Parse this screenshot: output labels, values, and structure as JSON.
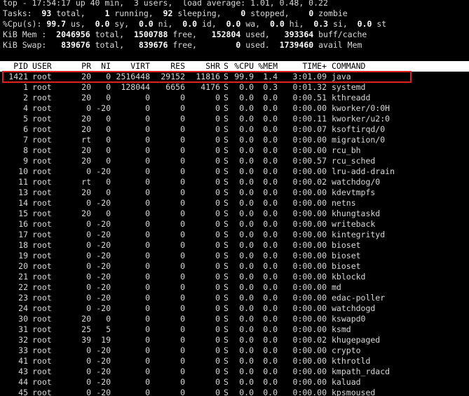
{
  "summary": {
    "top_line": "top - 17:54:17 up 40 min,  3 users,  load average: 1.01, 0.48, 0.22",
    "tasks": {
      "label": "Tasks:",
      "total": "93",
      "total_label": " total,",
      "running": "1",
      "running_label": " running,",
      "sleeping": "92",
      "sleeping_label": " sleeping,",
      "stopped": "0",
      "stopped_label": " stopped,",
      "zombie": "0",
      "zombie_label": " zombie"
    },
    "cpu": {
      "label": "%Cpu(s):",
      "us": "99.7",
      "us_label": " us,",
      "sy": "0.0",
      "sy_label": " sy,",
      "ni": "0.0",
      "ni_label": " ni,",
      "id": "0.0",
      "id_label": " id,",
      "wa": "0.0",
      "wa_label": " wa,",
      "hi": "0.0",
      "hi_label": " hi,",
      "si": "0.3",
      "si_label": " si,",
      "st": "0.0",
      "st_label": " st"
    },
    "mem": {
      "label": "KiB Mem :",
      "total": "2046956",
      "total_label": " total,",
      "free": "1500788",
      "free_label": " free,",
      "used": "152804",
      "used_label": " used,",
      "buff": "393364",
      "buff_label": " buff/cache"
    },
    "swap": {
      "label": "KiB Swap:",
      "total": "839676",
      "total_label": " total,",
      "free": "839676",
      "free_label": " free,",
      "used": "0",
      "used_label": " used.",
      "avail": "1739460",
      "avail_label": " avail Mem"
    }
  },
  "columns": [
    "PID",
    "USER",
    "PR",
    "NI",
    "VIRT",
    "RES",
    "SHR",
    "S",
    "%CPU",
    "%MEM",
    "TIME+",
    "COMMAND"
  ],
  "processes": [
    [
      "1421",
      "root",
      "20",
      "0",
      "2516448",
      "29152",
      "11816",
      "S",
      "99.9",
      "1.4",
      "3:01.09",
      "java"
    ],
    [
      "1",
      "root",
      "20",
      "0",
      "128044",
      "6656",
      "4176",
      "S",
      "0.0",
      "0.3",
      "0:01.32",
      "systemd"
    ],
    [
      "2",
      "root",
      "20",
      "0",
      "0",
      "0",
      "0",
      "S",
      "0.0",
      "0.0",
      "0:00.51",
      "kthreadd"
    ],
    [
      "4",
      "root",
      "0",
      "-20",
      "0",
      "0",
      "0",
      "S",
      "0.0",
      "0.0",
      "0:00.00",
      "kworker/0:0H"
    ],
    [
      "5",
      "root",
      "20",
      "0",
      "0",
      "0",
      "0",
      "S",
      "0.0",
      "0.0",
      "0:00.11",
      "kworker/u2:0"
    ],
    [
      "6",
      "root",
      "20",
      "0",
      "0",
      "0",
      "0",
      "S",
      "0.0",
      "0.0",
      "0:00.07",
      "ksoftirqd/0"
    ],
    [
      "7",
      "root",
      "rt",
      "0",
      "0",
      "0",
      "0",
      "S",
      "0.0",
      "0.0",
      "0:00.00",
      "migration/0"
    ],
    [
      "8",
      "root",
      "20",
      "0",
      "0",
      "0",
      "0",
      "S",
      "0.0",
      "0.0",
      "0:00.00",
      "rcu_bh"
    ],
    [
      "9",
      "root",
      "20",
      "0",
      "0",
      "0",
      "0",
      "S",
      "0.0",
      "0.0",
      "0:00.57",
      "rcu_sched"
    ],
    [
      "10",
      "root",
      "0",
      "-20",
      "0",
      "0",
      "0",
      "S",
      "0.0",
      "0.0",
      "0:00.00",
      "lru-add-drain"
    ],
    [
      "11",
      "root",
      "rt",
      "0",
      "0",
      "0",
      "0",
      "S",
      "0.0",
      "0.0",
      "0:00.02",
      "watchdog/0"
    ],
    [
      "13",
      "root",
      "20",
      "0",
      "0",
      "0",
      "0",
      "S",
      "0.0",
      "0.0",
      "0:00.00",
      "kdevtmpfs"
    ],
    [
      "14",
      "root",
      "0",
      "-20",
      "0",
      "0",
      "0",
      "S",
      "0.0",
      "0.0",
      "0:00.00",
      "netns"
    ],
    [
      "15",
      "root",
      "20",
      "0",
      "0",
      "0",
      "0",
      "S",
      "0.0",
      "0.0",
      "0:00.00",
      "khungtaskd"
    ],
    [
      "16",
      "root",
      "0",
      "-20",
      "0",
      "0",
      "0",
      "S",
      "0.0",
      "0.0",
      "0:00.00",
      "writeback"
    ],
    [
      "17",
      "root",
      "0",
      "-20",
      "0",
      "0",
      "0",
      "S",
      "0.0",
      "0.0",
      "0:00.00",
      "kintegrityd"
    ],
    [
      "18",
      "root",
      "0",
      "-20",
      "0",
      "0",
      "0",
      "S",
      "0.0",
      "0.0",
      "0:00.00",
      "bioset"
    ],
    [
      "19",
      "root",
      "0",
      "-20",
      "0",
      "0",
      "0",
      "S",
      "0.0",
      "0.0",
      "0:00.00",
      "bioset"
    ],
    [
      "20",
      "root",
      "0",
      "-20",
      "0",
      "0",
      "0",
      "S",
      "0.0",
      "0.0",
      "0:00.00",
      "bioset"
    ],
    [
      "21",
      "root",
      "0",
      "-20",
      "0",
      "0",
      "0",
      "S",
      "0.0",
      "0.0",
      "0:00.00",
      "kblockd"
    ],
    [
      "22",
      "root",
      "0",
      "-20",
      "0",
      "0",
      "0",
      "S",
      "0.0",
      "0.0",
      "0:00.00",
      "md"
    ],
    [
      "23",
      "root",
      "0",
      "-20",
      "0",
      "0",
      "0",
      "S",
      "0.0",
      "0.0",
      "0:00.00",
      "edac-poller"
    ],
    [
      "24",
      "root",
      "0",
      "-20",
      "0",
      "0",
      "0",
      "S",
      "0.0",
      "0.0",
      "0:00.00",
      "watchdogd"
    ],
    [
      "30",
      "root",
      "20",
      "0",
      "0",
      "0",
      "0",
      "S",
      "0.0",
      "0.0",
      "0:00.00",
      "kswapd0"
    ],
    [
      "31",
      "root",
      "25",
      "5",
      "0",
      "0",
      "0",
      "S",
      "0.0",
      "0.0",
      "0:00.00",
      "ksmd"
    ],
    [
      "32",
      "root",
      "39",
      "19",
      "0",
      "0",
      "0",
      "S",
      "0.0",
      "0.0",
      "0:00.02",
      "khugepaged"
    ],
    [
      "33",
      "root",
      "0",
      "-20",
      "0",
      "0",
      "0",
      "S",
      "0.0",
      "0.0",
      "0:00.00",
      "crypto"
    ],
    [
      "41",
      "root",
      "0",
      "-20",
      "0",
      "0",
      "0",
      "S",
      "0.0",
      "0.0",
      "0:00.00",
      "kthrotld"
    ],
    [
      "43",
      "root",
      "0",
      "-20",
      "0",
      "0",
      "0",
      "S",
      "0.0",
      "0.0",
      "0:00.00",
      "kmpath_rdacd"
    ],
    [
      "44",
      "root",
      "0",
      "-20",
      "0",
      "0",
      "0",
      "S",
      "0.0",
      "0.0",
      "0:00.00",
      "kaluad"
    ],
    [
      "45",
      "root",
      "0",
      "-20",
      "0",
      "0",
      "0",
      "S",
      "0.0",
      "0.0",
      "0:00.00",
      "kpsmoused"
    ]
  ],
  "colors": {
    "background": "#000000",
    "text": "#d8d8d8",
    "bold": "#ffffff",
    "header_bg": "#ffffff",
    "highlight_border": "#e01f1f"
  }
}
